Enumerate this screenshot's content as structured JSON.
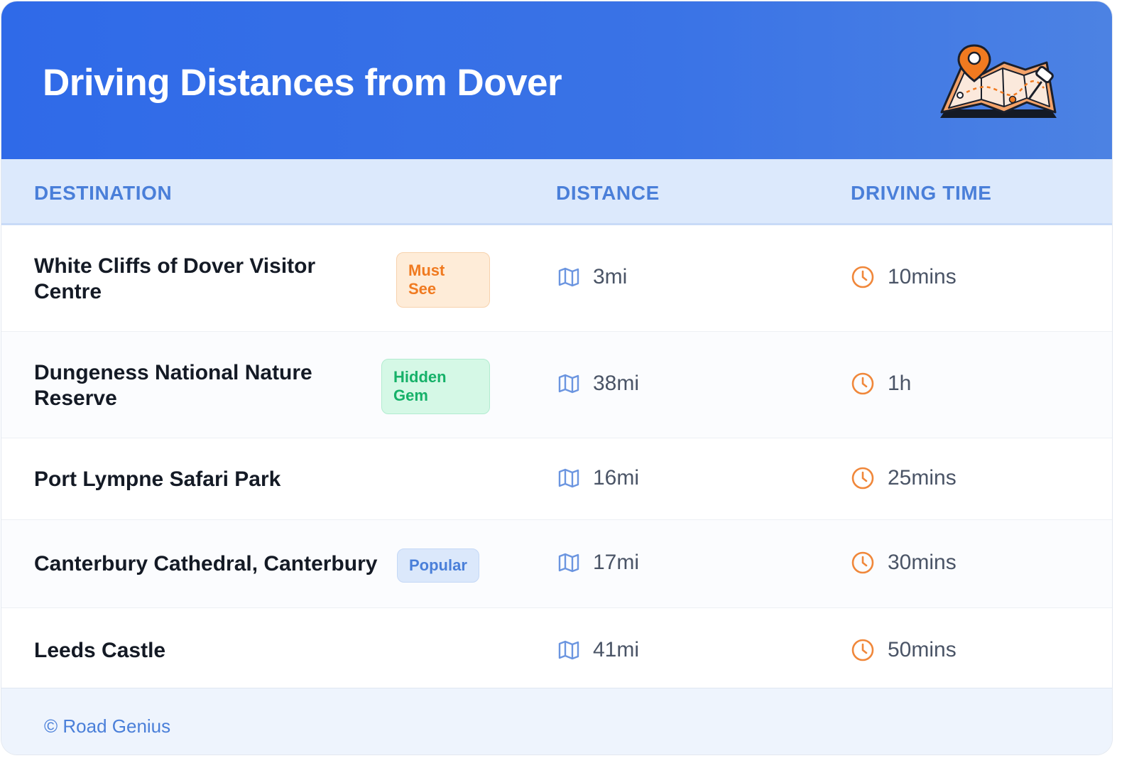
{
  "header": {
    "title": "Driving Distances from Dover"
  },
  "table": {
    "columns": [
      "DESTINATION",
      "DISTANCE",
      "DRIVING TIME"
    ],
    "rows": [
      {
        "destination_line1": "White Cliffs of Dover Visitor",
        "destination_line2": "Centre",
        "badge_line1": "Must",
        "badge_line2": "See",
        "distance": "3mi",
        "time": "10mins"
      },
      {
        "destination_line1": "Dungeness National Nature",
        "destination_line2": "Reserve",
        "badge_line1": "Hidden",
        "badge_line2": "Gem",
        "distance": "38mi",
        "time": "1h"
      },
      {
        "destination": "Port Lympne Safari Park",
        "distance": "16mi",
        "time": "25mins"
      },
      {
        "destination": "Canterbury Cathedral, Canterbury",
        "badge": "Popular",
        "distance": "17mi",
        "time": "30mins"
      },
      {
        "destination": "Leeds Castle",
        "distance": "41mi",
        "time": "50mins"
      }
    ]
  },
  "footer": {
    "credit": "© Road Genius"
  },
  "icons": {
    "distance": "map-icon",
    "time": "clock-icon",
    "header": "map-pin-illustration"
  },
  "colors": {
    "header": "#3069e8",
    "badge_must_see": "#f07a20",
    "badge_hidden_gem": "#16b169",
    "badge_popular": "#4a7fd9",
    "icon_time": "#f0873a",
    "icon_map": "#6b95e0"
  }
}
